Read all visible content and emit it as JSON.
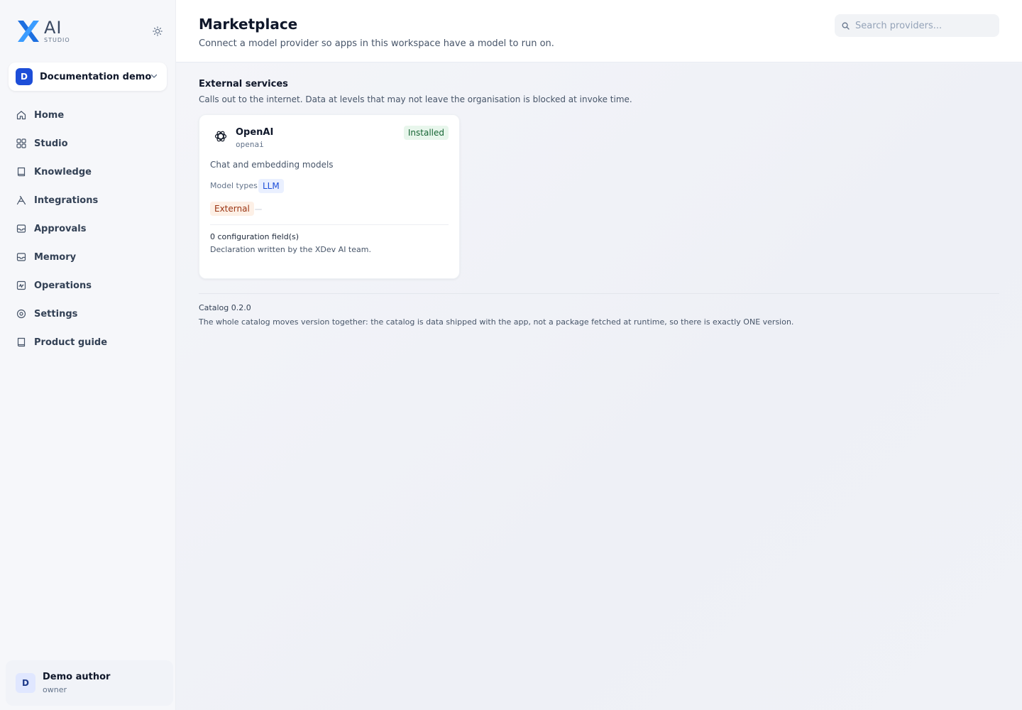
{
  "brand": {
    "name": "AI",
    "subtitle": "STUDIO",
    "accent": "#1d6fe0"
  },
  "workspace": {
    "initial": "D",
    "name": "Documentation demo"
  },
  "nav": {
    "items": [
      {
        "label": "Home",
        "icon": "home-icon"
      },
      {
        "label": "Studio",
        "icon": "grid-icon"
      },
      {
        "label": "Knowledge",
        "icon": "book-icon"
      },
      {
        "label": "Integrations",
        "icon": "tools-icon"
      },
      {
        "label": "Approvals",
        "icon": "inbox-icon"
      },
      {
        "label": "Memory",
        "icon": "inbox-icon"
      },
      {
        "label": "Operations",
        "icon": "activity-icon"
      },
      {
        "label": "Settings",
        "icon": "gear-icon"
      },
      {
        "label": "Product guide",
        "icon": "book-icon"
      }
    ]
  },
  "user": {
    "initial": "D",
    "name": "Demo author",
    "role": "owner"
  },
  "header": {
    "title": "Marketplace",
    "subtitle": "Connect a model provider so apps in this workspace have a model to run on.",
    "search_placeholder": "Search providers..."
  },
  "section": {
    "title": "External services",
    "description": "Calls out to the internet. Data at levels that may not leave the organisation is blocked at invoke time."
  },
  "provider": {
    "name": "OpenAI",
    "slug": "openai",
    "status": "Installed",
    "description": "Chat and embedding models",
    "model_types_label": "Model types",
    "model_types": [
      "LLM"
    ],
    "category": "External",
    "config_fields": "0 configuration field(s)",
    "declaration": "Declaration written by the XDev AI team."
  },
  "catalog": {
    "version": "Catalog 0.2.0",
    "note": "The whole catalog moves version together: the catalog is data shipped with the app, not a package fetched at runtime, so there is exactly ONE version."
  }
}
